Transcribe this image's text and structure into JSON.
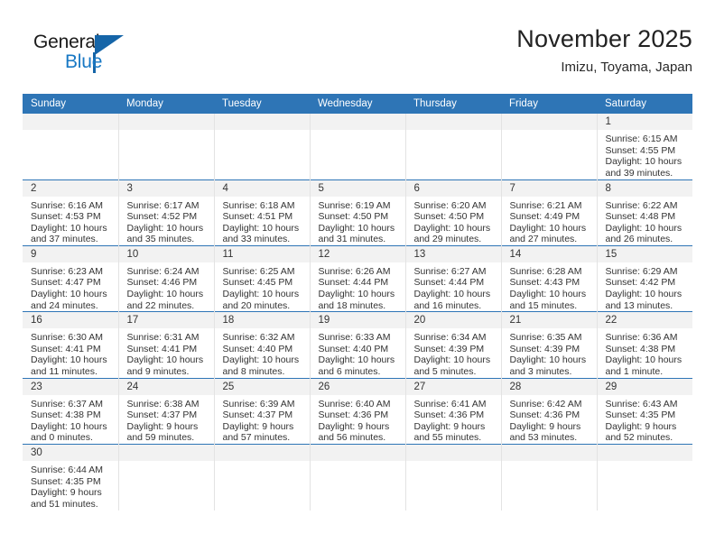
{
  "logo": {
    "word1": "General",
    "word2": "Blue",
    "triangle_icon": "logo-triangle-icon",
    "brand_color": "#1878c4",
    "accent_color": "#1565a8"
  },
  "header": {
    "title": "November 2025",
    "subtitle": "Imizu, Toyama, Japan"
  },
  "theme": {
    "header_blue": "#2e75b6",
    "daynum_band": "#f2f2f2",
    "grid_line": "#e3e3e3",
    "text": "#333333"
  },
  "weekdays": [
    "Sunday",
    "Monday",
    "Tuesday",
    "Wednesday",
    "Thursday",
    "Friday",
    "Saturday"
  ],
  "weeks": [
    [
      {
        "day": "",
        "blank": true
      },
      {
        "day": "",
        "blank": true
      },
      {
        "day": "",
        "blank": true
      },
      {
        "day": "",
        "blank": true
      },
      {
        "day": "",
        "blank": true
      },
      {
        "day": "",
        "blank": true
      },
      {
        "day": "1",
        "sunrise": "Sunrise: 6:15 AM",
        "sunset": "Sunset: 4:55 PM",
        "daylight1": "Daylight: 10 hours",
        "daylight2": "and 39 minutes."
      }
    ],
    [
      {
        "day": "2",
        "sunrise": "Sunrise: 6:16 AM",
        "sunset": "Sunset: 4:53 PM",
        "daylight1": "Daylight: 10 hours",
        "daylight2": "and 37 minutes."
      },
      {
        "day": "3",
        "sunrise": "Sunrise: 6:17 AM",
        "sunset": "Sunset: 4:52 PM",
        "daylight1": "Daylight: 10 hours",
        "daylight2": "and 35 minutes."
      },
      {
        "day": "4",
        "sunrise": "Sunrise: 6:18 AM",
        "sunset": "Sunset: 4:51 PM",
        "daylight1": "Daylight: 10 hours",
        "daylight2": "and 33 minutes."
      },
      {
        "day": "5",
        "sunrise": "Sunrise: 6:19 AM",
        "sunset": "Sunset: 4:50 PM",
        "daylight1": "Daylight: 10 hours",
        "daylight2": "and 31 minutes."
      },
      {
        "day": "6",
        "sunrise": "Sunrise: 6:20 AM",
        "sunset": "Sunset: 4:50 PM",
        "daylight1": "Daylight: 10 hours",
        "daylight2": "and 29 minutes."
      },
      {
        "day": "7",
        "sunrise": "Sunrise: 6:21 AM",
        "sunset": "Sunset: 4:49 PM",
        "daylight1": "Daylight: 10 hours",
        "daylight2": "and 27 minutes."
      },
      {
        "day": "8",
        "sunrise": "Sunrise: 6:22 AM",
        "sunset": "Sunset: 4:48 PM",
        "daylight1": "Daylight: 10 hours",
        "daylight2": "and 26 minutes."
      }
    ],
    [
      {
        "day": "9",
        "sunrise": "Sunrise: 6:23 AM",
        "sunset": "Sunset: 4:47 PM",
        "daylight1": "Daylight: 10 hours",
        "daylight2": "and 24 minutes."
      },
      {
        "day": "10",
        "sunrise": "Sunrise: 6:24 AM",
        "sunset": "Sunset: 4:46 PM",
        "daylight1": "Daylight: 10 hours",
        "daylight2": "and 22 minutes."
      },
      {
        "day": "11",
        "sunrise": "Sunrise: 6:25 AM",
        "sunset": "Sunset: 4:45 PM",
        "daylight1": "Daylight: 10 hours",
        "daylight2": "and 20 minutes."
      },
      {
        "day": "12",
        "sunrise": "Sunrise: 6:26 AM",
        "sunset": "Sunset: 4:44 PM",
        "daylight1": "Daylight: 10 hours",
        "daylight2": "and 18 minutes."
      },
      {
        "day": "13",
        "sunrise": "Sunrise: 6:27 AM",
        "sunset": "Sunset: 4:44 PM",
        "daylight1": "Daylight: 10 hours",
        "daylight2": "and 16 minutes."
      },
      {
        "day": "14",
        "sunrise": "Sunrise: 6:28 AM",
        "sunset": "Sunset: 4:43 PM",
        "daylight1": "Daylight: 10 hours",
        "daylight2": "and 15 minutes."
      },
      {
        "day": "15",
        "sunrise": "Sunrise: 6:29 AM",
        "sunset": "Sunset: 4:42 PM",
        "daylight1": "Daylight: 10 hours",
        "daylight2": "and 13 minutes."
      }
    ],
    [
      {
        "day": "16",
        "sunrise": "Sunrise: 6:30 AM",
        "sunset": "Sunset: 4:41 PM",
        "daylight1": "Daylight: 10 hours",
        "daylight2": "and 11 minutes."
      },
      {
        "day": "17",
        "sunrise": "Sunrise: 6:31 AM",
        "sunset": "Sunset: 4:41 PM",
        "daylight1": "Daylight: 10 hours",
        "daylight2": "and 9 minutes."
      },
      {
        "day": "18",
        "sunrise": "Sunrise: 6:32 AM",
        "sunset": "Sunset: 4:40 PM",
        "daylight1": "Daylight: 10 hours",
        "daylight2": "and 8 minutes."
      },
      {
        "day": "19",
        "sunrise": "Sunrise: 6:33 AM",
        "sunset": "Sunset: 4:40 PM",
        "daylight1": "Daylight: 10 hours",
        "daylight2": "and 6 minutes."
      },
      {
        "day": "20",
        "sunrise": "Sunrise: 6:34 AM",
        "sunset": "Sunset: 4:39 PM",
        "daylight1": "Daylight: 10 hours",
        "daylight2": "and 5 minutes."
      },
      {
        "day": "21",
        "sunrise": "Sunrise: 6:35 AM",
        "sunset": "Sunset: 4:39 PM",
        "daylight1": "Daylight: 10 hours",
        "daylight2": "and 3 minutes."
      },
      {
        "day": "22",
        "sunrise": "Sunrise: 6:36 AM",
        "sunset": "Sunset: 4:38 PM",
        "daylight1": "Daylight: 10 hours",
        "daylight2": "and 1 minute."
      }
    ],
    [
      {
        "day": "23",
        "sunrise": "Sunrise: 6:37 AM",
        "sunset": "Sunset: 4:38 PM",
        "daylight1": "Daylight: 10 hours",
        "daylight2": "and 0 minutes."
      },
      {
        "day": "24",
        "sunrise": "Sunrise: 6:38 AM",
        "sunset": "Sunset: 4:37 PM",
        "daylight1": "Daylight: 9 hours",
        "daylight2": "and 59 minutes."
      },
      {
        "day": "25",
        "sunrise": "Sunrise: 6:39 AM",
        "sunset": "Sunset: 4:37 PM",
        "daylight1": "Daylight: 9 hours",
        "daylight2": "and 57 minutes."
      },
      {
        "day": "26",
        "sunrise": "Sunrise: 6:40 AM",
        "sunset": "Sunset: 4:36 PM",
        "daylight1": "Daylight: 9 hours",
        "daylight2": "and 56 minutes."
      },
      {
        "day": "27",
        "sunrise": "Sunrise: 6:41 AM",
        "sunset": "Sunset: 4:36 PM",
        "daylight1": "Daylight: 9 hours",
        "daylight2": "and 55 minutes."
      },
      {
        "day": "28",
        "sunrise": "Sunrise: 6:42 AM",
        "sunset": "Sunset: 4:36 PM",
        "daylight1": "Daylight: 9 hours",
        "daylight2": "and 53 minutes."
      },
      {
        "day": "29",
        "sunrise": "Sunrise: 6:43 AM",
        "sunset": "Sunset: 4:35 PM",
        "daylight1": "Daylight: 9 hours",
        "daylight2": "and 52 minutes."
      }
    ],
    [
      {
        "day": "30",
        "sunrise": "Sunrise: 6:44 AM",
        "sunset": "Sunset: 4:35 PM",
        "daylight1": "Daylight: 9 hours",
        "daylight2": "and 51 minutes."
      },
      {
        "day": "",
        "blank": true
      },
      {
        "day": "",
        "blank": true
      },
      {
        "day": "",
        "blank": true
      },
      {
        "day": "",
        "blank": true
      },
      {
        "day": "",
        "blank": true
      },
      {
        "day": "",
        "blank": true
      }
    ]
  ]
}
